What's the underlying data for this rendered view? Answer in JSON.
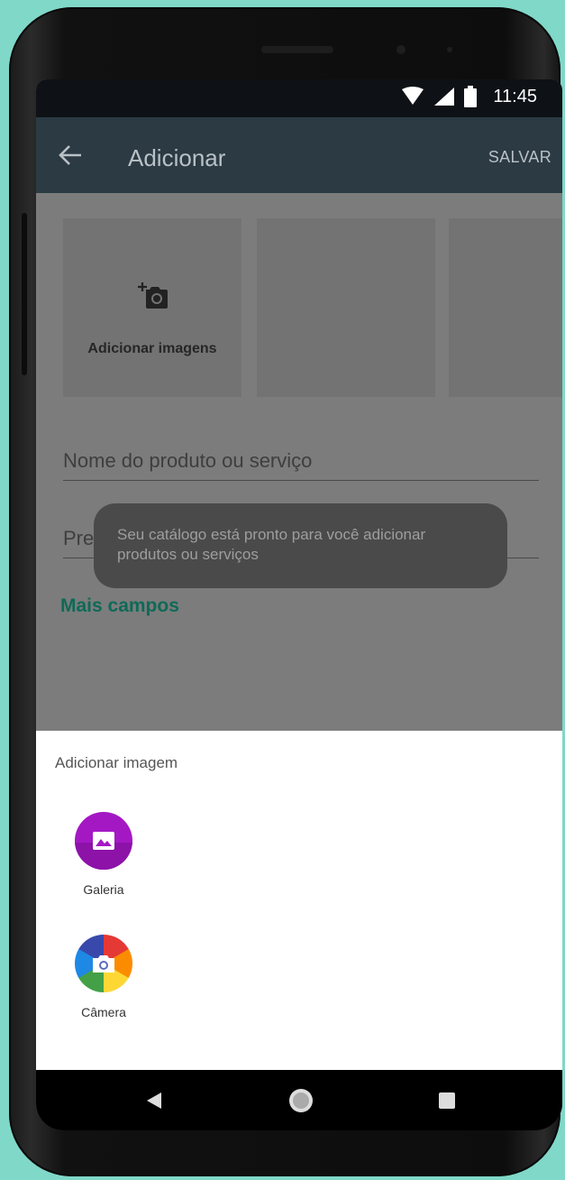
{
  "status_bar": {
    "time": "11:45"
  },
  "app_bar": {
    "title": "Adicionar",
    "save_label": "SALVAR"
  },
  "images": {
    "add_label": "Adicionar imagens"
  },
  "form": {
    "product_name_placeholder": "Nome do produto ou serviço",
    "price_placeholder_visible": "Pre",
    "more_fields_label": "Mais campos"
  },
  "toast": {
    "message": "Seu catálogo está pronto para você adicionar produtos ou serviços"
  },
  "bottom_sheet": {
    "title": "Adicionar imagem",
    "options": [
      {
        "label": "Galeria",
        "icon": "gallery-icon"
      },
      {
        "label": "Câmera",
        "icon": "camera-app-icon"
      }
    ]
  },
  "colors": {
    "accent": "#0e6a58",
    "app_bar": "#2b3a43",
    "background": "#7fd8c8"
  }
}
